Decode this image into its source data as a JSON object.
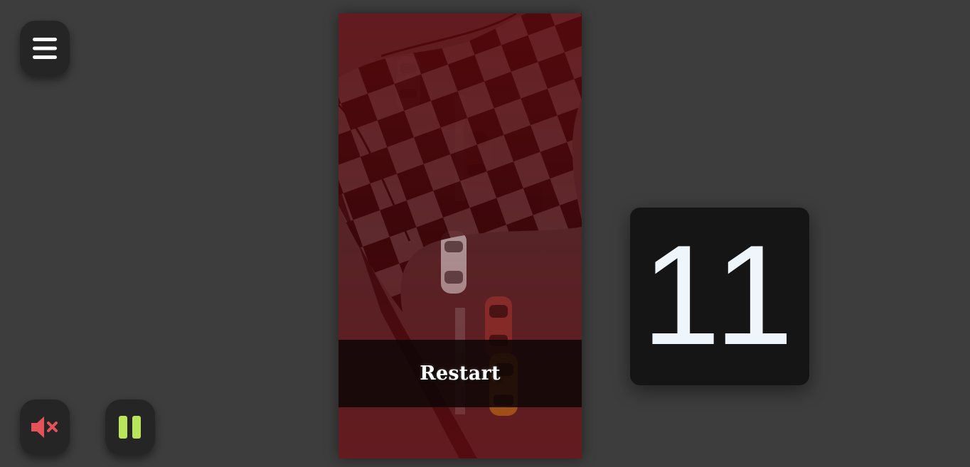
{
  "controls": {
    "menu_icon": "hamburger-menu-icon",
    "mute_icon": "speaker-muted-icon",
    "pause_icon": "pause-icon",
    "mute_color": "#e5525a",
    "pause_color": "#b9e55a"
  },
  "game": {
    "restart_label": "Restart",
    "score": "11",
    "overlay": "checkered-flag",
    "colors": {
      "road": "#50272a",
      "flag_dark": "#2f0306",
      "overlay_tint": "#8a1a1f"
    },
    "cars": [
      {
        "name": "car-top-left",
        "color": "#8d8d8d",
        "direction": "down"
      },
      {
        "name": "car-upper-center",
        "color": "#7a2020",
        "direction": "down"
      },
      {
        "name": "car-middle-white",
        "color": "#d8d8d8",
        "direction": "up"
      },
      {
        "name": "car-red",
        "color": "#b23a30",
        "direction": "up"
      },
      {
        "name": "car-player-yellow",
        "color": "#f2a21b",
        "direction": "up"
      }
    ]
  }
}
